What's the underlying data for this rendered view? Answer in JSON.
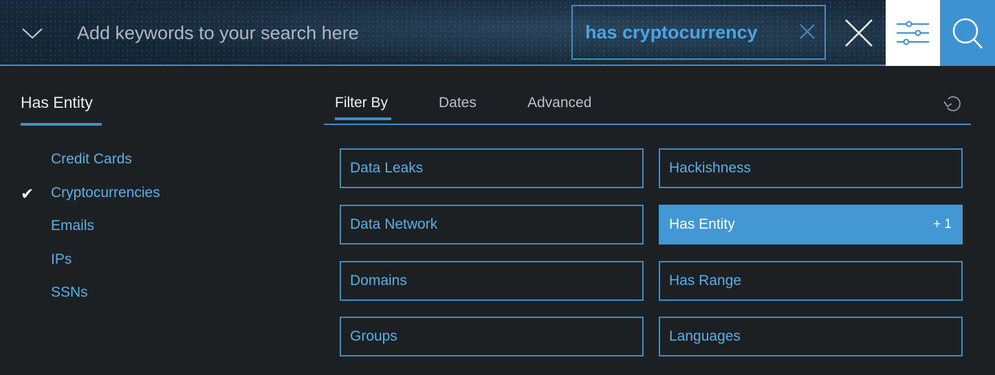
{
  "search": {
    "placeholder": "Add keywords to your search here",
    "value": "",
    "active_tag": "has cryptocurrency"
  },
  "icons": {
    "expand": "chevron-down-icon",
    "remove_tag": "close-icon",
    "clear": "close-icon",
    "filters": "sliders-icon",
    "search": "search-icon",
    "reset": "undo-icon"
  },
  "left_panel": {
    "title": "Has Entity",
    "items": [
      {
        "label": "Credit Cards",
        "checked": false
      },
      {
        "label": "Cryptocurrencies",
        "checked": true
      },
      {
        "label": "Emails",
        "checked": false
      },
      {
        "label": "IPs",
        "checked": false
      },
      {
        "label": "SSNs",
        "checked": false
      }
    ],
    "check_glyph": "✔"
  },
  "tabs": [
    {
      "label": "Filter By",
      "active": true
    },
    {
      "label": "Dates",
      "active": false
    },
    {
      "label": "Advanced",
      "active": false
    }
  ],
  "filters": [
    {
      "label": "Data Leaks",
      "active": false,
      "count": ""
    },
    {
      "label": "Hackishness",
      "active": false,
      "count": ""
    },
    {
      "label": "Data Network",
      "active": false,
      "count": ""
    },
    {
      "label": "Has Entity",
      "active": true,
      "count": "+ 1"
    },
    {
      "label": "Domains",
      "active": false,
      "count": ""
    },
    {
      "label": "Has Range",
      "active": false,
      "count": ""
    },
    {
      "label": "Groups",
      "active": false,
      "count": ""
    },
    {
      "label": "Languages",
      "active": false,
      "count": ""
    }
  ],
  "colors": {
    "accent": "#3e8fc9",
    "link": "#5aafe8",
    "active_fill": "#4397d3",
    "panel_bg": "#1d2022",
    "search_button": "#3d93d2"
  }
}
